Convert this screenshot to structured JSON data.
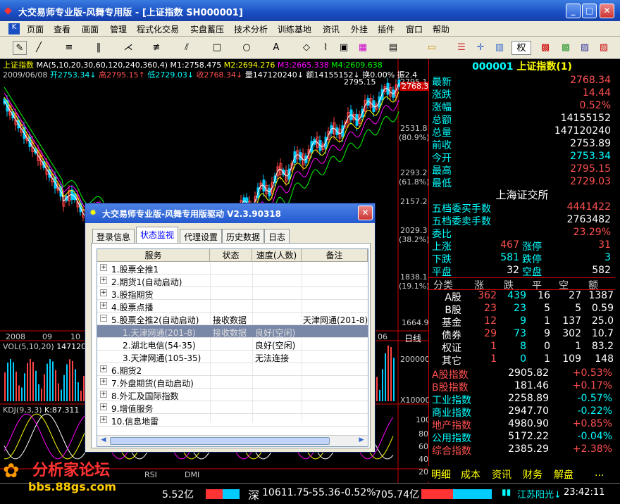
{
  "window": {
    "title": "大交易师专业版-风舞专用版 - [上证指数  SH000001]"
  },
  "menu": [
    "页面",
    "查看",
    "画面",
    "管理",
    "程式化交易",
    "实盘蓄压",
    "技术分析",
    "训练基地",
    "资讯",
    "外挂",
    "插件",
    "窗口",
    "帮助"
  ],
  "toolbar": {
    "quan_label": "权"
  },
  "chart": {
    "index_name": "上证指数",
    "ma_line": "MA(5,10,20,30,60,120,240,360,4)",
    "m1": "M1:2758.475",
    "m2": "M2:2694.276",
    "m3": "M3:2665.338",
    "m4": "M4:2609.638",
    "date": "2009/06/08",
    "open": "开2753.34↓",
    "high": "高2795.15↑",
    "low": "低2729.03↓",
    "close": "收2768.34↓",
    "vol": "量147120240↓",
    "amt": "额14155152↓",
    "chg": "换0.00%",
    "amp": "振2.4",
    "peak_label": "2795.15",
    "last_price_tag": "2768.3",
    "price_ticks": [
      "2795.1",
      "2531.8",
      "(80.9%)",
      "2293.2",
      "(61.8%)",
      "2157.2",
      "2029.3",
      "(38.2%)",
      "1838.1",
      "(19.1%)",
      "1664.9"
    ],
    "dates": [
      "2008",
      "09",
      "10",
      "06"
    ],
    "period": "日线",
    "vol_line": "VOL(5,10,20)",
    "vol_val": "147120",
    "vol_ticks": [
      "200000",
      "X10000"
    ],
    "kdj_line": "KDJ(9,3,3)",
    "kdj_k": "K:87.311",
    "kdj_ticks": [
      "100",
      "80",
      "60",
      "40",
      "20"
    ],
    "bottom_tabs": [
      "RSI",
      "DMI"
    ]
  },
  "quote": {
    "code": "000001",
    "name": "上证指数",
    "suffix": "(1)",
    "rows": [
      {
        "l": "最新",
        "v": "2768.34"
      },
      {
        "l": "涨跌",
        "v": "14.44"
      },
      {
        "l": "涨幅",
        "v": "0.52%"
      },
      {
        "l": "总额",
        "v": "14155152"
      },
      {
        "l": "总量",
        "v": "147120240"
      },
      {
        "l": "前收",
        "v": "2753.89"
      },
      {
        "l": "今开",
        "v": "2753.34"
      },
      {
        "l": "最高",
        "v": "2795.15"
      },
      {
        "l": "最低",
        "v": "2729.03"
      }
    ],
    "exchange": "上海证交所",
    "five_buy_l": "五档委买手数",
    "five_buy_v": "4441422",
    "five_sell_l": "五档委卖手数",
    "five_sell_v": "2763482",
    "wb_l": "委比",
    "wb_v": "23.29%",
    "up_l": "上涨",
    "up_v": "467",
    "zt_l": "涨停",
    "zt_v": "31",
    "down_l": "下跌",
    "down_v": "581",
    "dt_l": "跌停",
    "dt_v": "3",
    "flat_l": "平盘",
    "flat_v": "32",
    "kp_l": "空盘",
    "kp_v": "582",
    "cls_headers": [
      "分类",
      "涨",
      "跌",
      "平",
      "空",
      "额"
    ],
    "cls_rows": [
      [
        "A股",
        "362",
        "439",
        "16",
        "27",
        "1387"
      ],
      [
        "B股",
        "23",
        "23",
        "5",
        "5",
        "0.59"
      ],
      [
        "基金",
        "12",
        "9",
        "1",
        "137",
        "25.0"
      ],
      [
        "债券",
        "29",
        "73",
        "9",
        "302",
        "10.7"
      ],
      [
        "权证",
        "1",
        "8",
        "0",
        "1",
        "83.2"
      ],
      [
        "其它",
        "1",
        "0",
        "1",
        "109",
        "148"
      ]
    ],
    "indices": [
      {
        "n": "A股指数",
        "v": "2905.82",
        "c": "+0.53%"
      },
      {
        "n": "B股指数",
        "v": "181.46",
        "c": "+0.17%"
      },
      {
        "n": "工业指数",
        "v": "2258.89",
        "c": "-0.57%"
      },
      {
        "n": "商业指数",
        "v": "2947.70",
        "c": "-0.22%"
      },
      {
        "n": "地产指数",
        "v": "4980.90",
        "c": "+0.85%"
      },
      {
        "n": "公用指数",
        "v": "5172.22",
        "c": "-0.04%"
      },
      {
        "n": "综合指数",
        "v": "2385.29",
        "c": "+2.38%"
      }
    ],
    "tabs": [
      "明细",
      "成本",
      "资讯",
      "财务",
      "解盘",
      "..."
    ]
  },
  "dialog": {
    "title": "大交易师专业版-风舞专用版驱动 V2.3.90318",
    "tabs": [
      "登录信息",
      "状态监视",
      "代理设置",
      "历史数据",
      "日志"
    ],
    "cols": [
      "服务",
      "状态",
      "速度(人数)",
      "备注"
    ],
    "rows": [
      {
        "exp": "+",
        "name": "1.股票全推1",
        "status": "",
        "speed": "",
        "note": ""
      },
      {
        "exp": "+",
        "name": "2.期货1(自动启动)",
        "status": "",
        "speed": "",
        "note": ""
      },
      {
        "exp": "+",
        "name": "3.股指期货",
        "status": "",
        "speed": "",
        "note": ""
      },
      {
        "exp": "+",
        "name": "4.股票点播",
        "status": "",
        "speed": "",
        "note": ""
      },
      {
        "exp": "-",
        "name": "5.股票全推2(自动启动)",
        "status": "接收数据",
        "speed": "",
        "note": "天津网通(201-8)"
      },
      {
        "exp": "",
        "name": "1.天津网通(201-8)",
        "status": "接收数据",
        "speed": "良好(空闲)",
        "note": ""
      },
      {
        "exp": "",
        "name": "2.湖北电信(54-35)",
        "status": "",
        "speed": "良好(空闲)",
        "note": ""
      },
      {
        "exp": "",
        "name": "3.天津网通(105-35)",
        "status": "",
        "speed": "无法连接",
        "note": ""
      },
      {
        "exp": "+",
        "name": "6.期货2",
        "status": "",
        "speed": "",
        "note": ""
      },
      {
        "exp": "+",
        "name": "7.外盘期货(自动启动)",
        "status": "",
        "speed": "",
        "note": ""
      },
      {
        "exp": "+",
        "name": "8.外汇及国际指数",
        "status": "",
        "speed": "",
        "note": ""
      },
      {
        "exp": "+",
        "name": "9.增值服务",
        "status": "",
        "speed": "",
        "note": ""
      },
      {
        "exp": "+",
        "name": "10.信息地雷",
        "status": "",
        "speed": "",
        "note": ""
      }
    ]
  },
  "status": {
    "left_amt": "5.52亿",
    "shen_label": "深",
    "shen_val": "10611.75",
    "shen_chg": "-55.36",
    "shen_pct": "-0.52%",
    "shen_amt": "705.74亿",
    "ticker": "江苏阳光↓",
    "time": "23:42:11"
  },
  "logo": {
    "text": "分析家论坛",
    "url": "bbs.88gs.com"
  }
}
